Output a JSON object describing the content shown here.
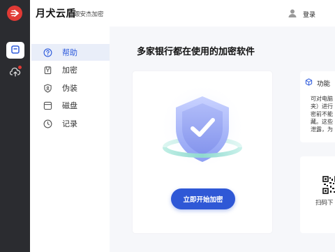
{
  "app": {
    "title": "月犬云盾",
    "subtitle": "跟安杰加密",
    "login_label": "登录"
  },
  "rail": {
    "items": [
      {
        "icon": "box-icon",
        "active": true
      },
      {
        "icon": "cloud-upload-icon",
        "has_badge": true
      }
    ]
  },
  "sidebar": {
    "items": [
      {
        "label": "帮助",
        "icon": "help-circle-icon",
        "active": true
      },
      {
        "label": "加密",
        "icon": "lock-icon"
      },
      {
        "label": "伪装",
        "icon": "disguise-shield-icon"
      },
      {
        "label": "磁盘",
        "icon": "disk-icon"
      },
      {
        "label": "记录",
        "icon": "clock-icon"
      }
    ]
  },
  "main": {
    "heading": "多家银行都在使用的加密软件",
    "start_button": "立即开始加密",
    "feature": {
      "title": "功能",
      "text": "可对电脑\n夹）进行\n密前不能\n藏。这些\n泄露，为"
    },
    "qr": {
      "label": "扫码下"
    }
  },
  "colors": {
    "accent": "#2f58d6",
    "rail_bg": "#2b2c30",
    "logo_red": "#e03a35"
  }
}
